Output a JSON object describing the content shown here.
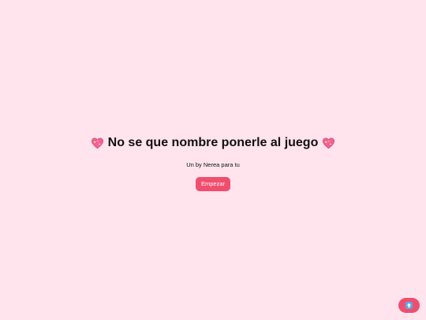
{
  "page": {
    "title_text": "No se que nombre ponerle al juego",
    "title_icon": "sparkling-heart-icon",
    "subtitle": "Un by Nerea para tu",
    "start_label": "Empezar"
  },
  "floating_button": {
    "icon": "up-arrow-icon"
  },
  "colors": {
    "background": "#ffe4ee",
    "accent": "#f04e6f",
    "heart": "#f06292",
    "text": "#111111"
  }
}
